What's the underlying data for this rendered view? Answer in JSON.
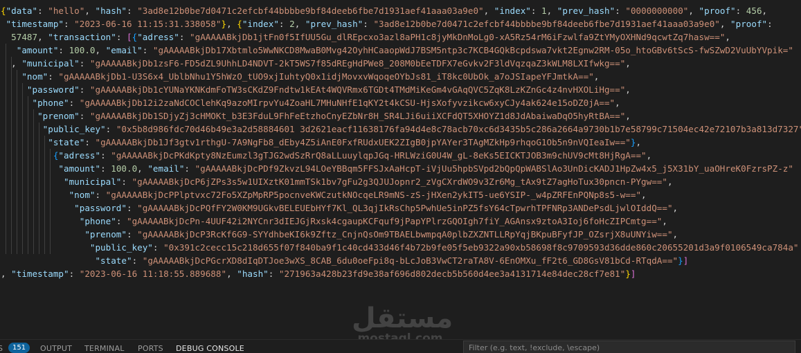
{
  "editor": {
    "lines": [
      [
        [
          "{",
          "brace"
        ],
        [
          "\"data\"",
          "key"
        ],
        [
          ": ",
          "punc"
        ],
        [
          "\"hello\"",
          "str"
        ],
        [
          ", ",
          "punc"
        ],
        [
          "\"hash\"",
          "key"
        ],
        [
          ": ",
          "punc"
        ],
        [
          "\"3ad8e12b0be7d0471c2efcbf44bbbbe9bf84deeb6fbe7d1931aef41aaa03a9e0\"",
          "str"
        ],
        [
          ", ",
          "punc"
        ],
        [
          "\"index\"",
          "key"
        ],
        [
          ": ",
          "punc"
        ],
        [
          "1",
          "num"
        ],
        [
          ", ",
          "punc"
        ],
        [
          "\"prev_hash\"",
          "key"
        ],
        [
          ": ",
          "punc"
        ],
        [
          "\"0000000000\"",
          "str"
        ],
        [
          ", ",
          "punc"
        ],
        [
          "\"proof\"",
          "key"
        ],
        [
          ": ",
          "punc"
        ],
        [
          "456",
          "num"
        ],
        [
          ",",
          "punc"
        ]
      ],
      [
        [
          " \"timestamp\"",
          "key"
        ],
        [
          ": ",
          "punc"
        ],
        [
          "\"2023-06-16 11:15:31.338058\"",
          "str"
        ],
        [
          "}",
          "brace"
        ],
        [
          ", ",
          "punc"
        ],
        [
          "{",
          "brace"
        ],
        [
          "\"index\"",
          "key"
        ],
        [
          ": ",
          "punc"
        ],
        [
          "2",
          "num"
        ],
        [
          ", ",
          "punc"
        ],
        [
          "\"prev_hash\"",
          "key"
        ],
        [
          ": ",
          "punc"
        ],
        [
          "\"3ad8e12b0be7d0471c2efcbf44bbbbe9bf84deeb6fbe7d1931aef41aaa03a9e0\"",
          "str"
        ],
        [
          ", ",
          "punc"
        ],
        [
          "\"proof\"",
          "key"
        ],
        [
          ":",
          "punc"
        ]
      ],
      [
        [
          "  57487",
          "num"
        ],
        [
          ", ",
          "punc"
        ],
        [
          "\"transaction\"",
          "key"
        ],
        [
          ": ",
          "punc"
        ],
        [
          "[",
          "bracket"
        ],
        [
          "{",
          "brace2"
        ],
        [
          "\"adress\"",
          "key"
        ],
        [
          ": ",
          "punc"
        ],
        [
          "\"gAAAAABkjDb1jtFn0f5IfUU5Gu_dlREpcxo3azl8aPH1c8jyMkDnMoLg0-xA5Rz54rM6iFzwlfa9ZtYMyOXHNd9qcwtZq7hasw==\"",
          "str"
        ],
        [
          ",",
          "punc"
        ]
      ],
      [
        [
          "   \"amount\"",
          "key"
        ],
        [
          ": ",
          "punc"
        ],
        [
          "100.0",
          "num"
        ],
        [
          ", ",
          "punc"
        ],
        [
          "\"email\"",
          "key"
        ],
        [
          ": ",
          "punc"
        ],
        [
          "\"gAAAAABkjDb17Xbtmlo5WwNKCD8MwaB0Mvg42OyhHCaaopWdJ7BSM5ntp3c7KCB4GQkBcpdswa7vkt2Egnw2RM-05o_htoGBv6tScS-fwSZwD2VuUbYVpik=\"",
          "str"
        ]
      ],
      [
        [
          "  , ",
          "punc"
        ],
        [
          "\"municipal\"",
          "key"
        ],
        [
          ": ",
          "punc"
        ],
        [
          "\"gAAAAABkjDb1zsF6-FD5dZL9UhhLD4NDVT-2kT5WS7f85dREgHdPWe8_208M0bEeTDFX7eGvkv2F3ldVqzqaZ3kWLM8LXIfwkg==\"",
          "str"
        ],
        [
          ",",
          "punc"
        ]
      ],
      [
        [
          "    \"nom\"",
          "key"
        ],
        [
          ": ",
          "punc"
        ],
        [
          "\"gAAAAABkjDb1-U3S6x4_UblbNhu1Y5hWzO_tUO9xjIuhtyQ0x1idjMovxvWqoqeOYbJs81_iT8kc0UbOk_a7oJSIapeYFJmtkA==\"",
          "str"
        ],
        [
          ",",
          "punc"
        ]
      ],
      [
        [
          "     \"password\"",
          "key"
        ],
        [
          ": ",
          "punc"
        ],
        [
          "\"gAAAAABkjDb1cYUNaYKNKdmFoTW3sCKdZ9Fndtw1kEAt4WQVRmx6TGDt4TMdMiKeGm4vGAqQVC5ZqK8LzKZnGc4z4nvHXOLiHg==\"",
          "str"
        ],
        [
          ",",
          "punc"
        ]
      ],
      [
        [
          "      \"phone\"",
          "key"
        ],
        [
          ": ",
          "punc"
        ],
        [
          "\"gAAAAABkjDb12i2zaNdCOClehKq9azoMIrpvYu4ZoaHL7MHuNHfE1qKY2t4kCSU-HjsXofyvzikcw6xyCJy4ak624e15oDZ0jA==\"",
          "str"
        ],
        [
          ",",
          "punc"
        ]
      ],
      [
        [
          "       \"prenom\"",
          "key"
        ],
        [
          ": ",
          "punc"
        ],
        [
          "\"gAAAAABkjDb1SDjyZj3cHMOKt_b3E3FduL9FhFeEtzhoCnyEZbNr8H_SR4LJi6uiiXCFdQT5XHOYZ1d8JdAbaiwaDqO5hyRtBA==\"",
          "str"
        ],
        [
          ",",
          "punc"
        ]
      ],
      [
        [
          "        \"public_key\"",
          "key"
        ],
        [
          ": ",
          "punc"
        ],
        [
          "\"0x5b8d986fdc70d46b49e3a2d58884601 3d2621eacf11638176fa94d4e8c78acb70xc6d3435b5c286a2664a9730b1b7e58799c71504ec42e72107b3a813d7327\"",
          "str"
        ]
      ],
      [
        [
          "         \"state\"",
          "key"
        ],
        [
          ": ",
          "punc"
        ],
        [
          "\"gAAAAABkjDb1Jf3gtv1rthgU-7A9NgFb8_dEby4Z5iAnE0FxfRUdxUEK2ZIgB0jpYAYer3TAgMZkHp9rhqoG1Ob5n9nVQIeaIw==\"",
          "str"
        ],
        [
          "}",
          "brace2"
        ],
        [
          ",",
          "punc"
        ]
      ],
      [
        [
          "          ",
          "punc"
        ],
        [
          "{",
          "brace2"
        ],
        [
          "\"adress\"",
          "key"
        ],
        [
          ": ",
          "punc"
        ],
        [
          "\"gAAAAABkjDcPKdKpty8NzEumzl3gTJG2wdSzRrQ8aLLuuylqpJGq-HRLWziG0U4W_gL-8eKs5EICKTJOB3m9chUV9cMt8HjRgA==\"",
          "str"
        ],
        [
          ",",
          "punc"
        ]
      ],
      [
        [
          "           \"amount\"",
          "key"
        ],
        [
          ": ",
          "punc"
        ],
        [
          "100.0",
          "num"
        ],
        [
          ", ",
          "punc"
        ],
        [
          "\"email\"",
          "key"
        ],
        [
          ": ",
          "punc"
        ],
        [
          "\"gAAAAABkjDcPDf9ZkvzL94LOeYBBqm5FFSJxAaHcpT-iVjUu5hpbSVpd2bQpQpWABSlAo3UnDicKADJ1HpZw4x5_j5X31bY_uaOHreK0FzrsPZ-z\"",
          "str"
        ]
      ],
      [
        [
          "            \"municipal\"",
          "key"
        ],
        [
          ": ",
          "punc"
        ],
        [
          "\"gAAAAABkjDcP6jZPs3s5w1UIXztK01mmTSk1bv7gFu2g3QJUJopnr2_zVgCXrdWO9v3Zr6Mg_tAx9tZ7agHoTux30pncn-PYgw==\"",
          "str"
        ],
        [
          ",",
          "punc"
        ]
      ],
      [
        [
          "             \"nom\"",
          "key"
        ],
        [
          ": ",
          "punc"
        ],
        [
          "\"gAAAAABkjDcPPlptvxc72Fo5XZpMpRP5pocnveKWCzutkNOcqeLR9mNS-zS-jHXen2ykIT5-ue6YSIP-_w4pZRFEnPQNp8s5-w==\"",
          "str"
        ],
        [
          ",",
          "punc"
        ]
      ],
      [
        [
          "              \"password\"",
          "key"
        ],
        [
          ": ",
          "punc"
        ],
        [
          "\"gAAAAABkjDcPQfFY2W0KM9UGkvBELEUEbHYf7Kl_QL3qjIkRsChp5PwhUe5inPZ5fsY64cTpwrhTPFNRp3ANDePsdLjwlOIddQ==\"",
          "str"
        ],
        [
          ",",
          "punc"
        ]
      ],
      [
        [
          "               \"phone\"",
          "key"
        ],
        [
          ": ",
          "punc"
        ],
        [
          "\"gAAAAABkjDcPn-4UUF42i2NYCnr3dIEJGjRxsk4cgaupKCFquf9jPapYPlrzGQOIgh7fiY_AGAnsx9ztoA3Ioj6foHcZIPCmtg==\"",
          "str"
        ],
        [
          ",",
          "punc"
        ]
      ],
      [
        [
          "                \"prenom\"",
          "key"
        ],
        [
          ": ",
          "punc"
        ],
        [
          "\"gAAAAABkjDcP3RcKf6G9-SYYdhbeKI6k9Zftz_CnjnQsOm9TBAELbwmpqA0plbZXZNTLLRpYqjBKpuBFyfJP_OZsrjX8uUNYiw==\"",
          "str"
        ],
        [
          ",",
          "punc"
        ]
      ],
      [
        [
          "                 \"public_key\"",
          "key"
        ],
        [
          ": ",
          "punc"
        ],
        [
          "\"0x391c2cecc15c218d655f07f840ba9f1c40cd433d46f4b72b9fe05f5eb9322a90xb58698f8c9709593d36dde860c20655201d3a9f0106549ca784a\"",
          "str"
        ]
      ],
      [
        [
          "                  \"state\"",
          "key"
        ],
        [
          ": ",
          "punc"
        ],
        [
          "\"gAAAAABkjDcPGcrXD8dIqDTJoe3wXS_8CAB_6du0oeFpi8q-bLcJoB3VwCT2raTA8V-6EnOMXu_fF2t6_GD8GsV81bCd-RTqdA==\"",
          "str"
        ],
        [
          "}",
          "brace2"
        ],
        [
          "]",
          "bracket"
        ]
      ],
      [
        [
          ", ",
          "punc"
        ],
        [
          "\"timestamp\"",
          "key"
        ],
        [
          ": ",
          "punc"
        ],
        [
          "\"2023-06-16 11:18:55.889688\"",
          "str"
        ],
        [
          ", ",
          "punc"
        ],
        [
          "\"hash\"",
          "key"
        ],
        [
          ": ",
          "punc"
        ],
        [
          "\"271963a428b23fd9e38af696d802decb5b560d4ee3a4131714e84dec28cf7e81\"",
          "str"
        ],
        [
          "}",
          "brace"
        ],
        [
          "]",
          "bracket"
        ]
      ]
    ]
  },
  "watermark": {
    "logo": "مستقل",
    "text": "mostaql.com"
  },
  "panel": {
    "badge_prefix": "S",
    "badge_count": "151",
    "tabs": [
      "OUTPUT",
      "TERMINAL",
      "PORTS",
      "DEBUG CONSOLE"
    ],
    "active_tab": "DEBUG CONSOLE",
    "filter_placeholder": "Filter (e.g. text, !exclude, \\escape)"
  },
  "colors": {
    "background": "#1e1e1e",
    "key": "#9cdcfe",
    "string": "#ce9178",
    "number": "#b5cea8",
    "brace": "#ffd700",
    "bracket": "#da70d6",
    "brace_nested": "#179fff",
    "badge": "#0e639c"
  }
}
